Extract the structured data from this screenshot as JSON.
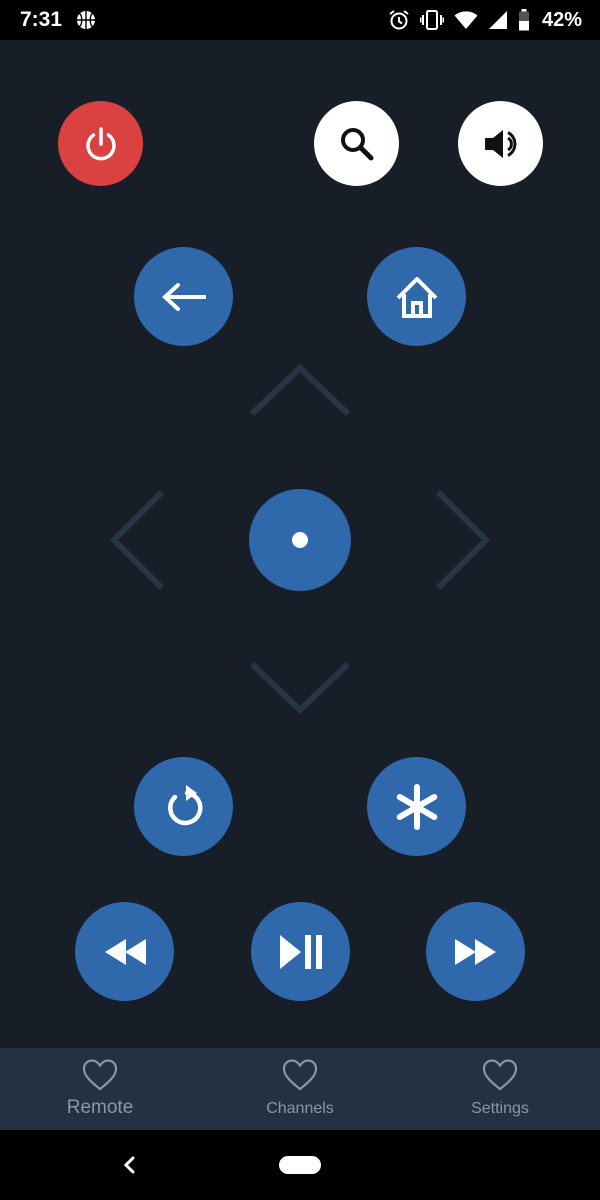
{
  "status_bar": {
    "time": "7:31",
    "battery_percent": "42%",
    "icons": [
      "basketball-icon",
      "alarm-icon",
      "vibrate-icon",
      "wifi-icon",
      "cell-signal-icon",
      "battery-icon"
    ]
  },
  "buttons": {
    "power": "power-icon",
    "search": "search-icon",
    "volume": "volume-icon",
    "back": "back-arrow-icon",
    "home": "home-icon",
    "ok": "ok-dot-icon",
    "replay": "replay-icon",
    "options": "asterisk-icon",
    "rewind": "rewind-icon",
    "play_pause": "play-pause-icon",
    "fast_forward": "fast-forward-icon"
  },
  "dpad": [
    "up",
    "left",
    "right",
    "down"
  ],
  "tabs": [
    {
      "label": "Remote",
      "icon": "heart-outline-icon",
      "active": true
    },
    {
      "label": "Channels",
      "icon": "heart-outline-icon",
      "active": false
    },
    {
      "label": "Settings",
      "icon": "heart-outline-icon",
      "active": false
    }
  ],
  "colors": {
    "background": "#171e28",
    "blue_button": "#2f69ab",
    "red_button": "#d94240",
    "tab_bar": "#243142",
    "dpad_arrow": "#283546",
    "tab_text": "#8e96a0"
  }
}
